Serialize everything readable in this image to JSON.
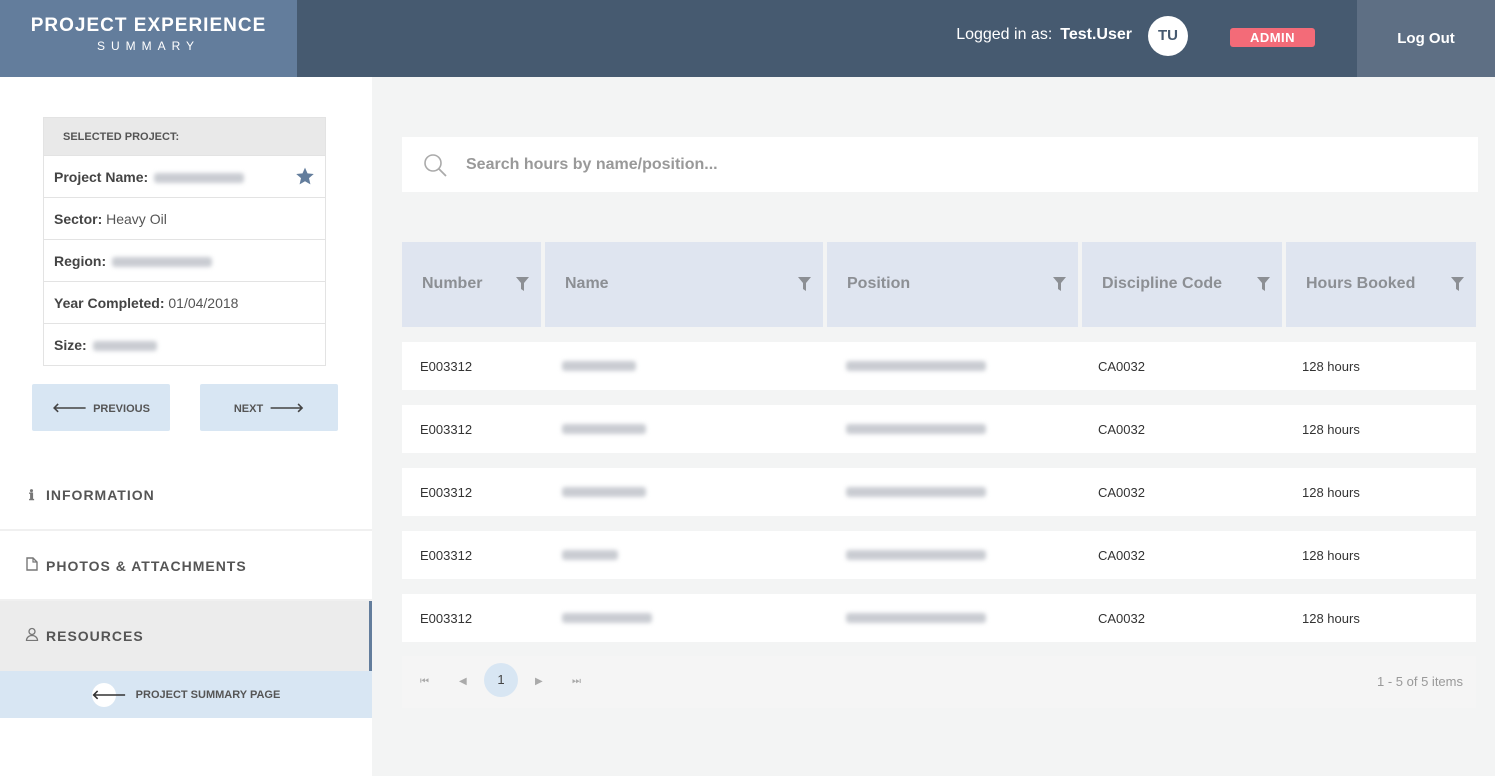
{
  "header": {
    "brand_title": "PROJECT EXPERIENCE",
    "brand_sub": "SUMMARY",
    "logged_label": "Logged in as:",
    "username": "Test.User",
    "avatar": "TU",
    "role_badge": "ADMIN",
    "logout_label": "Log Out"
  },
  "project": {
    "heading": "SELECTED PROJECT:",
    "name_label": "Project Name:",
    "sector_label": "Sector:",
    "sector_value": "Heavy Oil",
    "region_label": "Region:",
    "year_label": "Year Completed:",
    "year_value": "01/04/2018",
    "size_label": "Size:"
  },
  "nav": {
    "previous": "PREVIOUS",
    "next": "NEXT",
    "menu": [
      {
        "label": "INFORMATION",
        "icon": "info-icon"
      },
      {
        "label": "PHOTOS & ATTACHMENTS",
        "icon": "file-icon"
      },
      {
        "label": "RESOURCES",
        "icon": "user-icon"
      }
    ],
    "summary_page": "PROJECT SUMMARY PAGE"
  },
  "search": {
    "placeholder": "Search hours by name/position..."
  },
  "table": {
    "columns": [
      "Number",
      "Name",
      "Position",
      "Discipline Code",
      "Hours Booked"
    ],
    "rows": [
      {
        "number": "E003312",
        "code": "CA0032",
        "hours": "128 hours"
      },
      {
        "number": "E003312",
        "code": "CA0032",
        "hours": "128 hours"
      },
      {
        "number": "E003312",
        "code": "CA0032",
        "hours": "128 hours"
      },
      {
        "number": "E003312",
        "code": "CA0032",
        "hours": "128 hours"
      },
      {
        "number": "E003312",
        "code": "CA0032",
        "hours": "128 hours"
      }
    ]
  },
  "pager": {
    "current": "1",
    "info": "1 - 5 of 5 items"
  },
  "colors": {
    "header": "#465a70",
    "brand": "#637d9c",
    "badge": "#f36b78",
    "accent_light": "#d8e6f3",
    "table_header": "#dfe5f0"
  }
}
